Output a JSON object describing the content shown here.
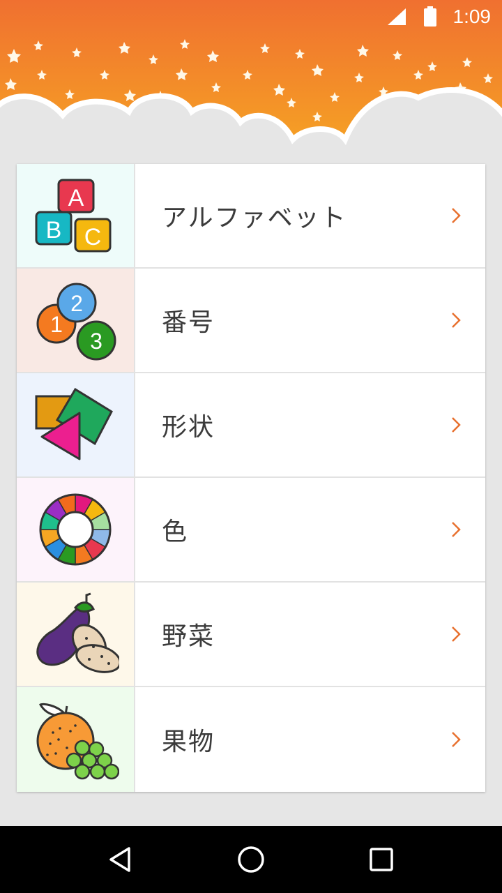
{
  "status_bar": {
    "time": "1:09"
  },
  "colors": {
    "header_top": "#f07030",
    "header_bottom": "#f5a623",
    "cloud": "#e6e6e6",
    "chevron": "#e8702e",
    "label_text": "#3b3b3b",
    "nav_bar": "#000000"
  },
  "menu": {
    "items": [
      {
        "label": "アルファベット",
        "icon": "abc-blocks-icon",
        "tile_color": "#eefcfa"
      },
      {
        "label": "番号",
        "icon": "numbers-icon",
        "tile_color": "#f9e9e4"
      },
      {
        "label": "形状",
        "icon": "shapes-icon",
        "tile_color": "#edf3fd"
      },
      {
        "label": "色",
        "icon": "color-wheel-icon",
        "tile_color": "#fdf3fb"
      },
      {
        "label": "野菜",
        "icon": "vegetables-icon",
        "tile_color": "#fef8ea"
      },
      {
        "label": "果物",
        "icon": "fruits-icon",
        "tile_color": "#eefced"
      }
    ]
  },
  "nav": {
    "back_icon": "back-triangle-icon",
    "home_icon": "home-circle-icon",
    "recents_icon": "recents-square-icon"
  }
}
